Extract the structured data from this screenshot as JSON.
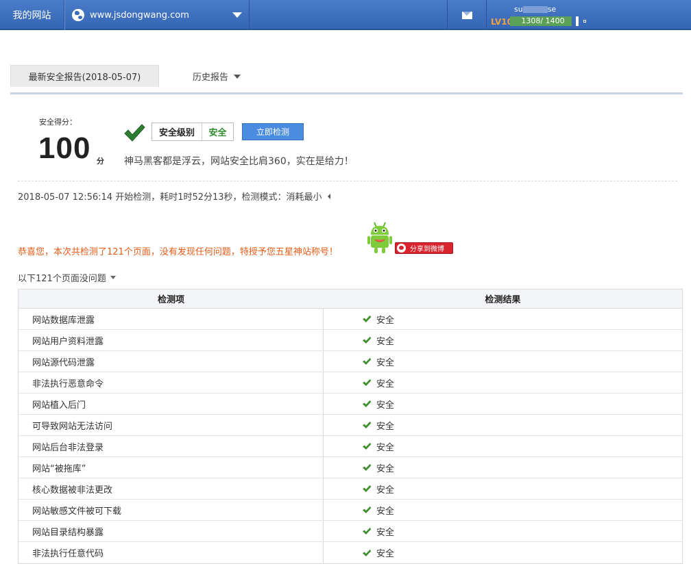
{
  "topbar": {
    "site_label": "我的网站",
    "domain": "www.jsdongwang.com",
    "user_name_prefix": "su",
    "user_name_suffix": "se",
    "level": "LV10",
    "exp_text": "1308/ 1400",
    "exp_progress": 0.934
  },
  "tabs": {
    "latest": "最新安全报告(2018-05-07)",
    "history": "历史报告"
  },
  "score": {
    "label": "安全得分：",
    "value": "100",
    "unit": "分",
    "level_label": "安全级别",
    "level_value": "安全",
    "detect_button": "立即检测",
    "slogan": "神马黑客都是浮云，网站安全比肩360，实在是给力！"
  },
  "scan_info": "2018-05-07 12:56:14 开始检测，耗时1时52分13秒，检测模式：消耗最小",
  "congrats": "恭喜您，本次共检测了121个页面，没有发现任何问题，特授予您五星神站称号！",
  "weibo_share": "分享到微博",
  "list_heading": "以下121个页面没问题",
  "table": {
    "col_item": "检测项",
    "col_result": "检测结果",
    "rows": [
      {
        "item": "网站数据库泄露",
        "result": "安全"
      },
      {
        "item": "网站用户资料泄露",
        "result": "安全"
      },
      {
        "item": "网站源代码泄露",
        "result": "安全"
      },
      {
        "item": "非法执行恶意命令",
        "result": "安全"
      },
      {
        "item": "网站植入后门",
        "result": "安全"
      },
      {
        "item": "可导致网站无法访问",
        "result": "安全"
      },
      {
        "item": "网站后台非法登录",
        "result": "安全"
      },
      {
        "item": "网站“被拖库”",
        "result": "安全"
      },
      {
        "item": "核心数据被非法更改",
        "result": "安全"
      },
      {
        "item": "网站敏感文件被可下载",
        "result": "安全"
      },
      {
        "item": "网站目录结构暴露",
        "result": "安全"
      },
      {
        "item": "非法执行任意代码",
        "result": "安全"
      }
    ]
  },
  "colors": {
    "topbar": "#3a6bbb",
    "safe_green": "#2e8b2e",
    "congrats_orange": "#e45b16",
    "button_blue": "#4a8cdf"
  }
}
